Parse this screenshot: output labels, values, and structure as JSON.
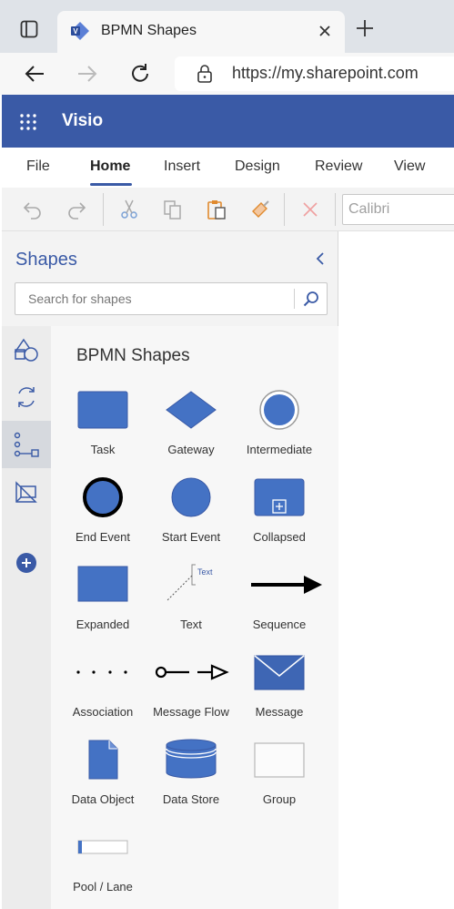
{
  "browser": {
    "tab_title": "BPMN Shapes",
    "url": "https://my.sharepoint.com"
  },
  "app": {
    "name": "Visio"
  },
  "ribbon": {
    "tabs": [
      "File",
      "Home",
      "Insert",
      "Design",
      "Review",
      "View"
    ],
    "active_tab": "Home",
    "font_name": "Calibri"
  },
  "pane": {
    "title": "Shapes",
    "search_placeholder": "Search for shapes",
    "stencil_title": "BPMN Shapes",
    "shapes": [
      {
        "label": "Task",
        "icon": "task-shape-icon"
      },
      {
        "label": "Gateway",
        "icon": "gateway-shape-icon"
      },
      {
        "label": "Intermediate",
        "icon": "intermediate-event-icon"
      },
      {
        "label": "End Event",
        "icon": "end-event-icon"
      },
      {
        "label": "Start Event",
        "icon": "start-event-icon"
      },
      {
        "label": "Collapsed",
        "icon": "collapsed-subprocess-icon"
      },
      {
        "label": "Expanded",
        "icon": "expanded-subprocess-icon"
      },
      {
        "label": "Text",
        "icon": "text-annotation-icon",
        "inner_text": "Text"
      },
      {
        "label": "Sequence",
        "icon": "sequence-flow-icon"
      },
      {
        "label": "Association",
        "icon": "association-icon"
      },
      {
        "label": "Message Flow",
        "icon": "message-flow-icon"
      },
      {
        "label": "Message",
        "icon": "message-envelope-icon"
      },
      {
        "label": "Data Object",
        "icon": "data-object-icon"
      },
      {
        "label": "Data Store",
        "icon": "data-store-icon"
      },
      {
        "label": "Group",
        "icon": "group-box-icon"
      },
      {
        "label": "Pool / Lane",
        "icon": "pool-lane-icon"
      }
    ]
  },
  "colors": {
    "brand": "#3a5aa6",
    "shape_fill": "#4472c4"
  }
}
